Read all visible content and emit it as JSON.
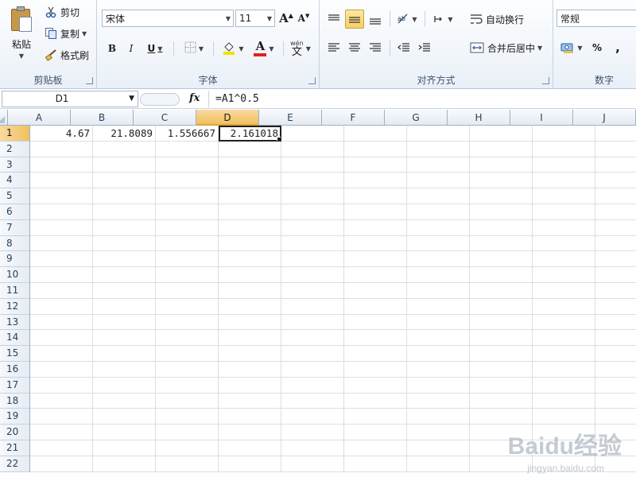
{
  "ribbon": {
    "clipboard": {
      "group_label": "剪贴板",
      "paste_label": "粘贴",
      "cut_label": "剪切",
      "copy_label": "复制",
      "format_painter_label": "格式刷"
    },
    "font": {
      "group_label": "字体",
      "font_name": "宋体",
      "font_size": "11",
      "bold": "B",
      "italic": "I",
      "underline": "U",
      "grow_font": "A",
      "shrink_font": "A",
      "font_color_letter": "A",
      "phonetic": "文",
      "phonetic_top": "wén",
      "font_color": "#e02020",
      "fill_color": "#f3e200"
    },
    "alignment": {
      "group_label": "对齐方式",
      "wrap_text_label": "自动换行",
      "merge_center_label": "合并后居中"
    },
    "number": {
      "group_label": "数字",
      "format_value": "常规",
      "percent": "%",
      "comma": ","
    }
  },
  "formula_bar": {
    "name_box": "D1",
    "fx": "fx",
    "formula": "=A1^0.5"
  },
  "sheet": {
    "columns": [
      "A",
      "B",
      "C",
      "D",
      "E",
      "F",
      "G",
      "H",
      "I",
      "J"
    ],
    "selected_column": "D",
    "selected_row": "1",
    "rows": [
      {
        "label": "1",
        "cells": [
          "4.67",
          "21.8089",
          "1.556667",
          "2.161018",
          "",
          "",
          "",
          "",
          "",
          ""
        ]
      },
      {
        "label": "2",
        "cells": []
      },
      {
        "label": "3",
        "cells": []
      },
      {
        "label": "4",
        "cells": []
      },
      {
        "label": "5",
        "cells": []
      },
      {
        "label": "6",
        "cells": []
      },
      {
        "label": "7",
        "cells": []
      },
      {
        "label": "8",
        "cells": []
      },
      {
        "label": "9",
        "cells": []
      },
      {
        "label": "10",
        "cells": []
      },
      {
        "label": "11",
        "cells": []
      },
      {
        "label": "12",
        "cells": []
      },
      {
        "label": "13",
        "cells": []
      },
      {
        "label": "14",
        "cells": []
      },
      {
        "label": "15",
        "cells": []
      },
      {
        "label": "16",
        "cells": []
      },
      {
        "label": "17",
        "cells": []
      },
      {
        "label": "18",
        "cells": []
      },
      {
        "label": "19",
        "cells": []
      },
      {
        "label": "20",
        "cells": []
      },
      {
        "label": "21",
        "cells": []
      },
      {
        "label": "22",
        "cells": []
      }
    ]
  },
  "watermark": {
    "brand": "Baidu经验",
    "url": "jingyan.baidu.com"
  }
}
